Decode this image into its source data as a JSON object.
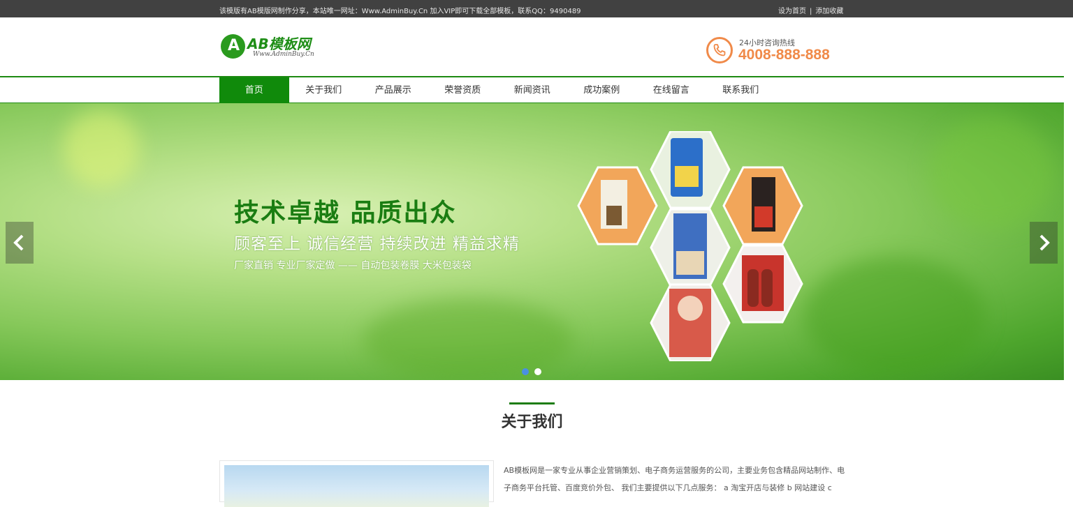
{
  "topbar": {
    "notice": "该模版有AB模版网制作分享，本站唯一网址：Www.AdminBuy.Cn 加入VIP即可下载全部模板，联系QQ：9490489",
    "set_home": "设为首页",
    "separator": "|",
    "add_favorite": "添加收藏"
  },
  "header": {
    "logo_letter": "A",
    "logo_name": "AB模板网",
    "logo_site": "Www.AdminBuy.Cn",
    "hotline_label": "24小时咨询热线",
    "hotline_number": "4008-888-888"
  },
  "nav": {
    "items": [
      "首页",
      "关于我们",
      "产品展示",
      "荣誉资质",
      "新闻资讯",
      "成功案例",
      "在线留言",
      "联系我们"
    ],
    "active_index": 0
  },
  "banner": {
    "headline": "技术卓越  品质出众",
    "subtitle": "顾客至上 诚信经营 持续改进 精益求精",
    "tagline": "厂家直销 专业厂家定做 —— 自动包装卷膜 大米包装袋",
    "slide_count": 2,
    "active_slide": 0
  },
  "about": {
    "title": "关于我们",
    "text": "AB模板网是一家专业从事企业营销策划、电子商务运营服务的公司，主要业务包含精品网站制作、电子商务平台托管、百度竞价外包、 我们主要提供以下几点服务： a 淘宝开店与装修 b 网站建设 c"
  },
  "colors": {
    "brand_green": "#108a0b",
    "topbar_bg": "#414141",
    "hotline_orange": "#f08a49",
    "active_dot": "#4a90e2"
  },
  "icons": {
    "phone": "phone-icon",
    "prev": "chevron-left-icon",
    "next": "chevron-right-icon"
  }
}
